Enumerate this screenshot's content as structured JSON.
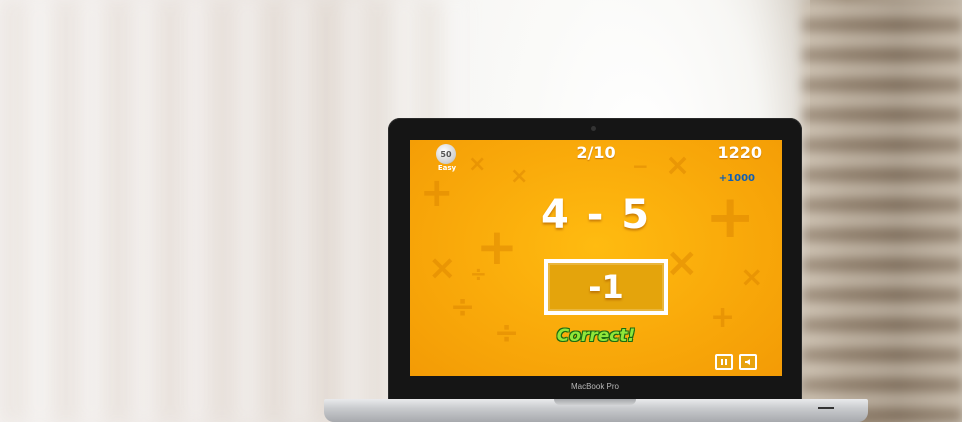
{
  "laptop": {
    "brand": "MacBook Pro"
  },
  "game": {
    "level_badge": "50",
    "level_name": "Easy",
    "progress": "2/10",
    "score": "1220",
    "bonus": "+1000",
    "question": "4 - 5",
    "answer": "-1",
    "feedback": "Correct!",
    "buttons": {
      "pause_icon": "pause-icon",
      "sound_icon": "sound-icon"
    }
  },
  "colors": {
    "screen_bg": "#f9a90a",
    "feedback_text": "#8fe63a",
    "bonus_text": "#0f5fb4"
  }
}
